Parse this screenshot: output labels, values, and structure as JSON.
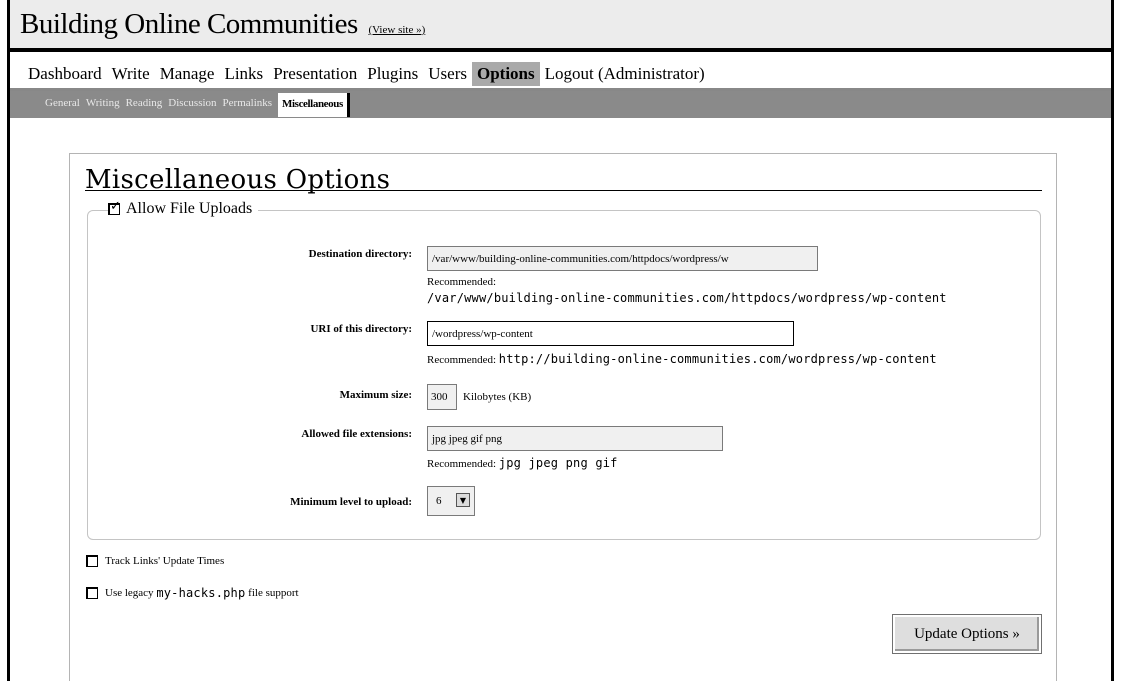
{
  "header": {
    "site_title": "Building Online Communities",
    "view_site": "(View site »)"
  },
  "menu": [
    {
      "label": "Dashboard",
      "active": false
    },
    {
      "label": "Write",
      "active": false
    },
    {
      "label": "Manage",
      "active": false
    },
    {
      "label": "Links",
      "active": false
    },
    {
      "label": "Presentation",
      "active": false
    },
    {
      "label": "Plugins",
      "active": false
    },
    {
      "label": "Users",
      "active": false
    },
    {
      "label": "Options",
      "active": true
    },
    {
      "label": "Logout (Administrator)",
      "active": false
    }
  ],
  "submenu": [
    {
      "label": "General",
      "active": false
    },
    {
      "label": "Writing",
      "active": false
    },
    {
      "label": "Reading",
      "active": false
    },
    {
      "label": "Discussion",
      "active": false
    },
    {
      "label": "Permalinks",
      "active": false
    },
    {
      "label": "Miscellaneous",
      "active": true
    }
  ],
  "panel": {
    "title": "Miscellaneous Options",
    "uploads": {
      "legend": "Allow File Uploads",
      "checked": true,
      "destination": {
        "label": "Destination directory:",
        "value": "/var/www/building-online-communities.com/httpdocs/wordpress/w",
        "recommended_label": "Recommended:",
        "recommended_value": "/var/www/building-online-communities.com/httpdocs/wordpress/wp-content"
      },
      "uri": {
        "label": "URI of this directory:",
        "value": "/wordpress/wp-content",
        "recommended_label": "Recommended:",
        "recommended_value": "http://building-online-communities.com/wordpress/wp-content"
      },
      "max_size": {
        "label": "Maximum size:",
        "value": "300",
        "unit": "Kilobytes (KB)"
      },
      "extensions": {
        "label": "Allowed file extensions:",
        "value": "jpg jpeg gif png",
        "recommended_label": "Recommended:",
        "recommended_value": "jpg jpeg png gif"
      },
      "min_level": {
        "label": "Minimum level to upload:",
        "value": "6"
      }
    },
    "track_links": {
      "label": "Track Links' Update Times",
      "checked": false
    },
    "legacy": {
      "label_prefix": "Use legacy",
      "code": "my-hacks.php",
      "label_suffix": "file support",
      "checked": false
    },
    "submit_label": "Update Options »"
  }
}
